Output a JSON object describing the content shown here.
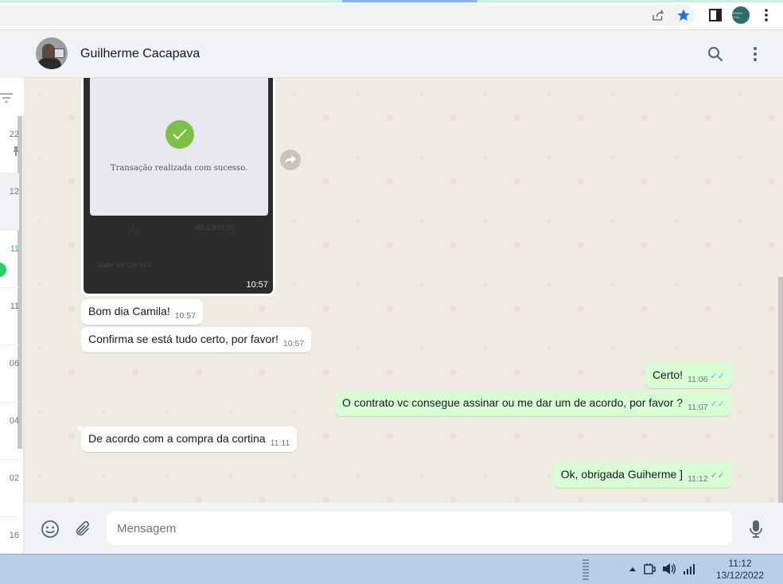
{
  "browser": {
    "profile_initials": "JORGE LEAL"
  },
  "sidebar": {
    "rows": [
      {
        "time": "22"
      },
      {
        "time": "12"
      },
      {
        "time": "11"
      },
      {
        "time": "11"
      },
      {
        "time": "06"
      },
      {
        "time": "04"
      },
      {
        "time": "02"
      },
      {
        "time": "16"
      }
    ]
  },
  "chat": {
    "contact_name": "Guilherme Cacapava",
    "image_message": {
      "caption_text": "Transação realizada com sucesso.",
      "faint_qty": "1",
      "faint_value": "R$ 1.920,00",
      "faint_label": "Valor da Compra",
      "time": "10:57"
    },
    "messages": [
      {
        "direction": "in",
        "text": "Bom dia Camila!",
        "time": "10:57"
      },
      {
        "direction": "in",
        "text": "Confirma se está tudo certo,  por favor!",
        "time": "10:57"
      },
      {
        "direction": "out",
        "text": "Certo!",
        "time": "11:06",
        "status": "read"
      },
      {
        "direction": "out",
        "text": "O contrato vc consegue assinar ou me dar um de acordo, por favor ?",
        "time": "11:07",
        "status": "read"
      },
      {
        "direction": "in",
        "text": "De acordo com a compra da cortina",
        "time": "11:11"
      },
      {
        "direction": "out",
        "text": "Ok, obrigada Guiherme ]",
        "time": "11:12",
        "status": "delivered"
      }
    ]
  },
  "compose": {
    "placeholder": "Mensagem"
  },
  "taskbar": {
    "time": "11:12",
    "date": "13/12/2022"
  },
  "colors": {
    "out_bubble": "#d9fdd3",
    "in_bubble": "#ffffff",
    "read_ticks": "#53bdeb",
    "unread_badge": "#25d366",
    "chrome_star": "#1a73e8"
  }
}
